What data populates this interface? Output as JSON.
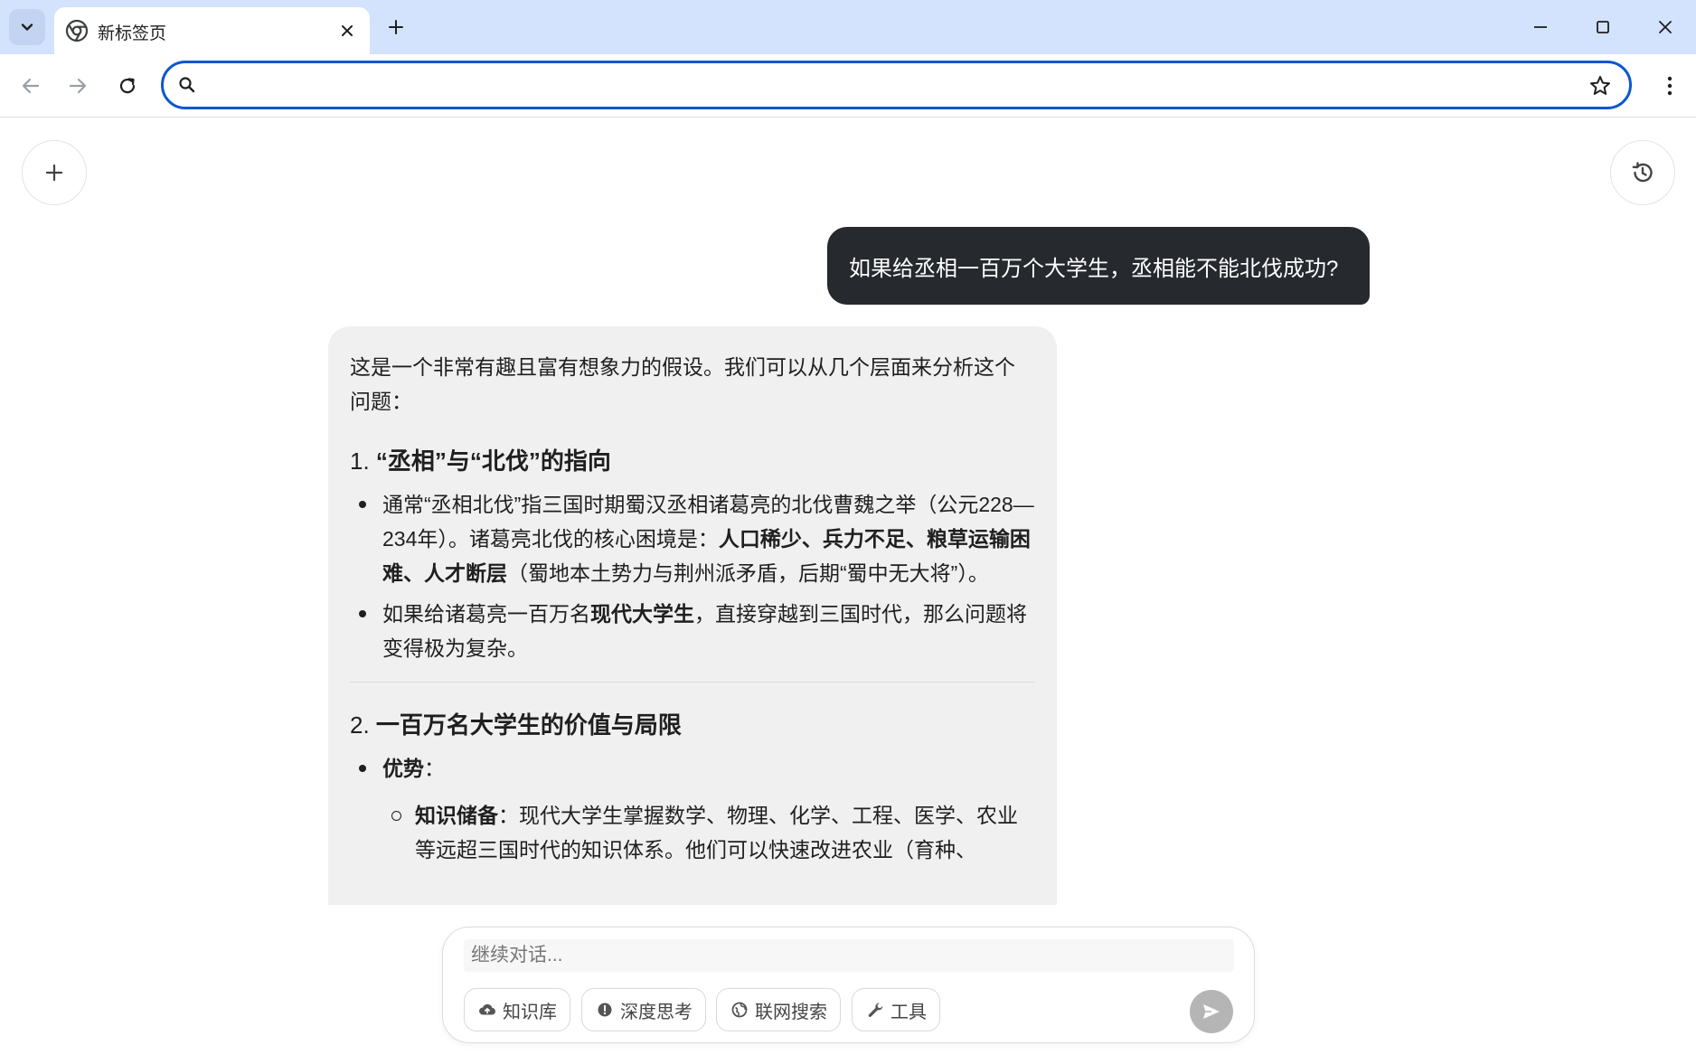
{
  "browser": {
    "tab_title": "新标签页",
    "address_placeholder": "",
    "address_value": ""
  },
  "chat": {
    "user_message": "如果给丞相一百万个大学生，丞相能不能北伐成功?",
    "answer": {
      "intro": "这是一个非常有趣且富有想象力的假设。我们可以从几个层面来分析这个问题：",
      "sections": [
        {
          "number": "1.",
          "heading": "“丞相”与“北伐”的指向",
          "bullets": [
            {
              "text_a": "通常“丞相北伐”指三国时期蜀汉丞相诸葛亮的北伐曹魏之举（公元228—234年）。诸葛亮北伐的核心困境是：",
              "bold": "人口稀少、兵力不足、粮草运输困难、人才断层",
              "text_b": "（蜀地本土势力与荆州派矛盾，后期“蜀中无大将”）。"
            },
            {
              "text_a": "如果给诸葛亮一百万名",
              "bold": "现代大学生",
              "text_b": "，直接穿越到三国时代，那么问题将变得极为复杂。"
            }
          ]
        },
        {
          "number": "2.",
          "heading": "一百万名大学生的价值与局限",
          "bullet_label": "优势",
          "bullet_suffix": "：",
          "sub_bold": "知识储备",
          "sub_text": "：现代大学生掌握数学、物理、化学、工程、医学、农业等远超三国时代的知识体系。他们可以快速改进农业（育种、"
        }
      ]
    }
  },
  "composer": {
    "placeholder": "继续对话...",
    "tools": [
      {
        "icon": "cloud-upload-icon",
        "label": "知识库"
      },
      {
        "icon": "alert-circle-icon",
        "label": "深度思考"
      },
      {
        "icon": "globe-icon",
        "label": "联网搜索"
      },
      {
        "icon": "wrench-icon",
        "label": "工具"
      }
    ]
  },
  "colors": {
    "tabstrip": "#d3e3fd",
    "omnibox_border": "#0b57d0",
    "user_bubble": "#26292e",
    "answer_card": "#f0f0f0",
    "send_button": "#b5b5b5"
  }
}
